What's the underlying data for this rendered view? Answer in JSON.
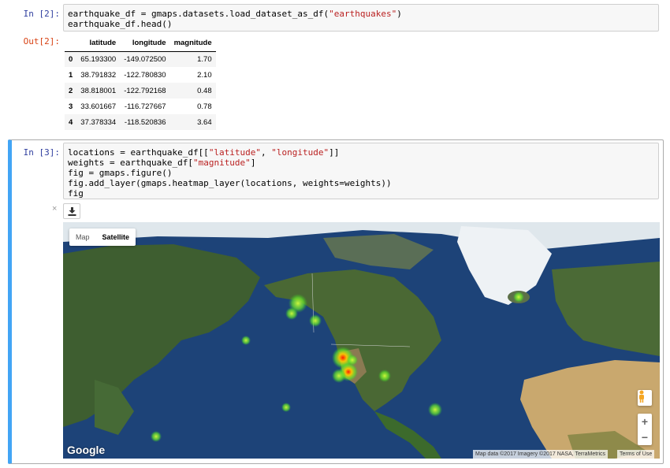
{
  "cell2": {
    "in_prompt": "In [2]:",
    "code": [
      [
        {
          "t": "earthquake_df = gmaps.datasets.load_dataset_as_df("
        },
        {
          "t": "\"earthquakes\"",
          "s": true
        },
        {
          "t": ")"
        }
      ],
      [
        {
          "t": "earthquake_df.head()"
        }
      ]
    ],
    "out_prompt": "Out[2]:",
    "table": {
      "columns": [
        "latitude",
        "longitude",
        "magnitude"
      ],
      "rows": [
        {
          "index": "0",
          "latitude": "65.193300",
          "longitude": "-149.072500",
          "magnitude": "1.70"
        },
        {
          "index": "1",
          "latitude": "38.791832",
          "longitude": "-122.780830",
          "magnitude": "2.10"
        },
        {
          "index": "2",
          "latitude": "38.818001",
          "longitude": "-122.792168",
          "magnitude": "0.48"
        },
        {
          "index": "3",
          "latitude": "33.601667",
          "longitude": "-116.727667",
          "magnitude": "0.78"
        },
        {
          "index": "4",
          "latitude": "37.378334",
          "longitude": "-118.520836",
          "magnitude": "3.64"
        }
      ]
    }
  },
  "cell3": {
    "in_prompt": "In [3]:",
    "code": [
      [
        {
          "t": "locations = earthquake_df[["
        },
        {
          "t": "\"latitude\"",
          "s": true
        },
        {
          "t": ", "
        },
        {
          "t": "\"longitude\"",
          "s": true
        },
        {
          "t": "]]"
        }
      ],
      [
        {
          "t": "weights = earthquake_df["
        },
        {
          "t": "\"magnitude\"",
          "s": true
        },
        {
          "t": "]"
        }
      ],
      [
        {
          "t": "fig = gmaps.figure()"
        }
      ],
      [
        {
          "t": "fig.add_layer(gmaps.heatmap_layer(locations, weights=weights))"
        }
      ],
      [
        {
          "t": "fig"
        }
      ]
    ]
  },
  "widget": {
    "close_label": "×",
    "download_icon": "download-icon"
  },
  "map": {
    "maptype_map": "Map",
    "maptype_satellite": "Satellite",
    "google_logo": "Google",
    "attribution": "Map data ©2017 Imagery ©2017 NASA, TerraMetrics",
    "terms": "Terms of Use",
    "zoom_in": "+",
    "zoom_out": "−",
    "colors": {
      "ocean": "#1a3d70",
      "land": "#3f5f2e",
      "ice": "#e8eef2",
      "desert": "#c9a46a",
      "heat_low": "#7cff3a",
      "heat_high": "#ff2a00"
    }
  }
}
